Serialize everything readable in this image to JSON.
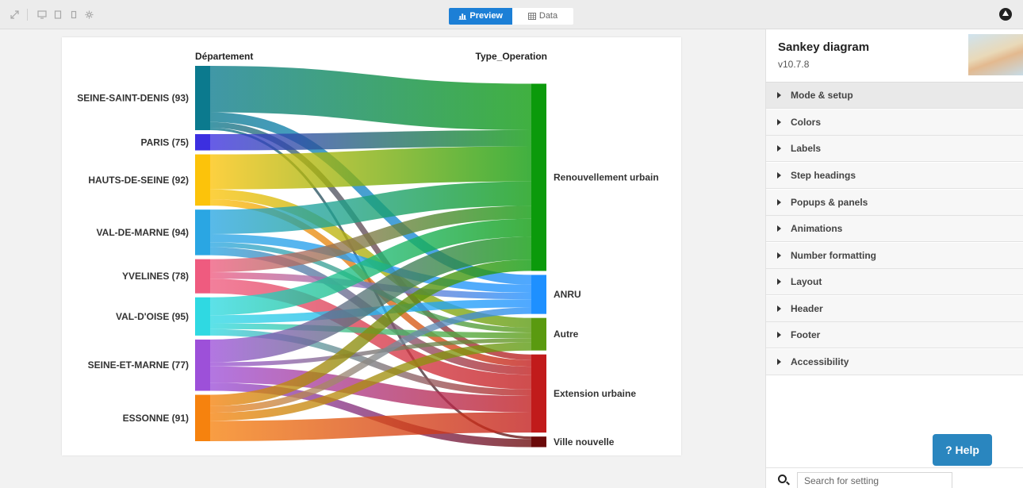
{
  "toolbar": {
    "preview_label": "Preview",
    "data_label": "Data",
    "icons": [
      "expand-icon",
      "desktop-icon",
      "tablet-icon",
      "mobile-icon",
      "settings-icon"
    ]
  },
  "panel": {
    "title": "Sankey diagram",
    "version": "v10.7.8",
    "sections": [
      "Mode & setup",
      "Colors",
      "Labels",
      "Step headings",
      "Popups & panels",
      "Animations",
      "Number formatting",
      "Layout",
      "Header",
      "Footer",
      "Accessibility"
    ],
    "help_label": "? Help",
    "search_placeholder": "Search for setting"
  },
  "chart_data": {
    "type": "sankey",
    "headings": [
      "Département",
      "Type_Operation"
    ],
    "sources": [
      {
        "name": "SEINE-SAINT-DENIS (93)",
        "color": "#0b7a8e"
      },
      {
        "name": "PARIS (75)",
        "color": "#3c2fe0"
      },
      {
        "name": "HAUTS-DE-SEINE (92)",
        "color": "#fcc30a"
      },
      {
        "name": "VAL-DE-MARNE (94)",
        "color": "#2aa6e3"
      },
      {
        "name": "YVELINES (78)",
        "color": "#ef5b7f"
      },
      {
        "name": "VAL-D'OISE (95)",
        "color": "#2fd9e2"
      },
      {
        "name": "SEINE-ET-MARNE (77)",
        "color": "#9d50d9"
      },
      {
        "name": "ESSONNE (91)",
        "color": "#f6820e"
      }
    ],
    "targets": [
      {
        "name": "Renouvellement urbain",
        "color": "#0b9a0b"
      },
      {
        "name": "ANRU",
        "color": "#1e90ff"
      },
      {
        "name": "Autre",
        "color": "#5a9a10"
      },
      {
        "name": "Extension urbaine",
        "color": "#c11b1b"
      },
      {
        "name": "Ville nouvelle",
        "color": "#6b0a0a"
      }
    ],
    "links": [
      {
        "source": 0,
        "target": 0,
        "value": 57
      },
      {
        "source": 0,
        "target": 1,
        "value": 12
      },
      {
        "source": 0,
        "target": 3,
        "value": 7
      },
      {
        "source": 0,
        "target": 4,
        "value": 3
      },
      {
        "source": 1,
        "target": 0,
        "value": 20
      },
      {
        "source": 2,
        "target": 0,
        "value": 43
      },
      {
        "source": 2,
        "target": 2,
        "value": 12
      },
      {
        "source": 2,
        "target": 3,
        "value": 8
      },
      {
        "source": 3,
        "target": 0,
        "value": 30
      },
      {
        "source": 3,
        "target": 1,
        "value": 10
      },
      {
        "source": 3,
        "target": 2,
        "value": 6
      },
      {
        "source": 3,
        "target": 3,
        "value": 10
      },
      {
        "source": 4,
        "target": 0,
        "value": 16
      },
      {
        "source": 4,
        "target": 1,
        "value": 8
      },
      {
        "source": 4,
        "target": 3,
        "value": 18
      },
      {
        "source": 5,
        "target": 0,
        "value": 22
      },
      {
        "source": 5,
        "target": 1,
        "value": 10
      },
      {
        "source": 5,
        "target": 2,
        "value": 7
      },
      {
        "source": 5,
        "target": 3,
        "value": 8
      },
      {
        "source": 6,
        "target": 0,
        "value": 28
      },
      {
        "source": 6,
        "target": 2,
        "value": 5
      },
      {
        "source": 6,
        "target": 3,
        "value": 20
      },
      {
        "source": 6,
        "target": 4,
        "value": 10
      },
      {
        "source": 7,
        "target": 0,
        "value": 14
      },
      {
        "source": 7,
        "target": 1,
        "value": 8
      },
      {
        "source": 7,
        "target": 2,
        "value": 10
      },
      {
        "source": 7,
        "target": 3,
        "value": 25
      }
    ]
  }
}
